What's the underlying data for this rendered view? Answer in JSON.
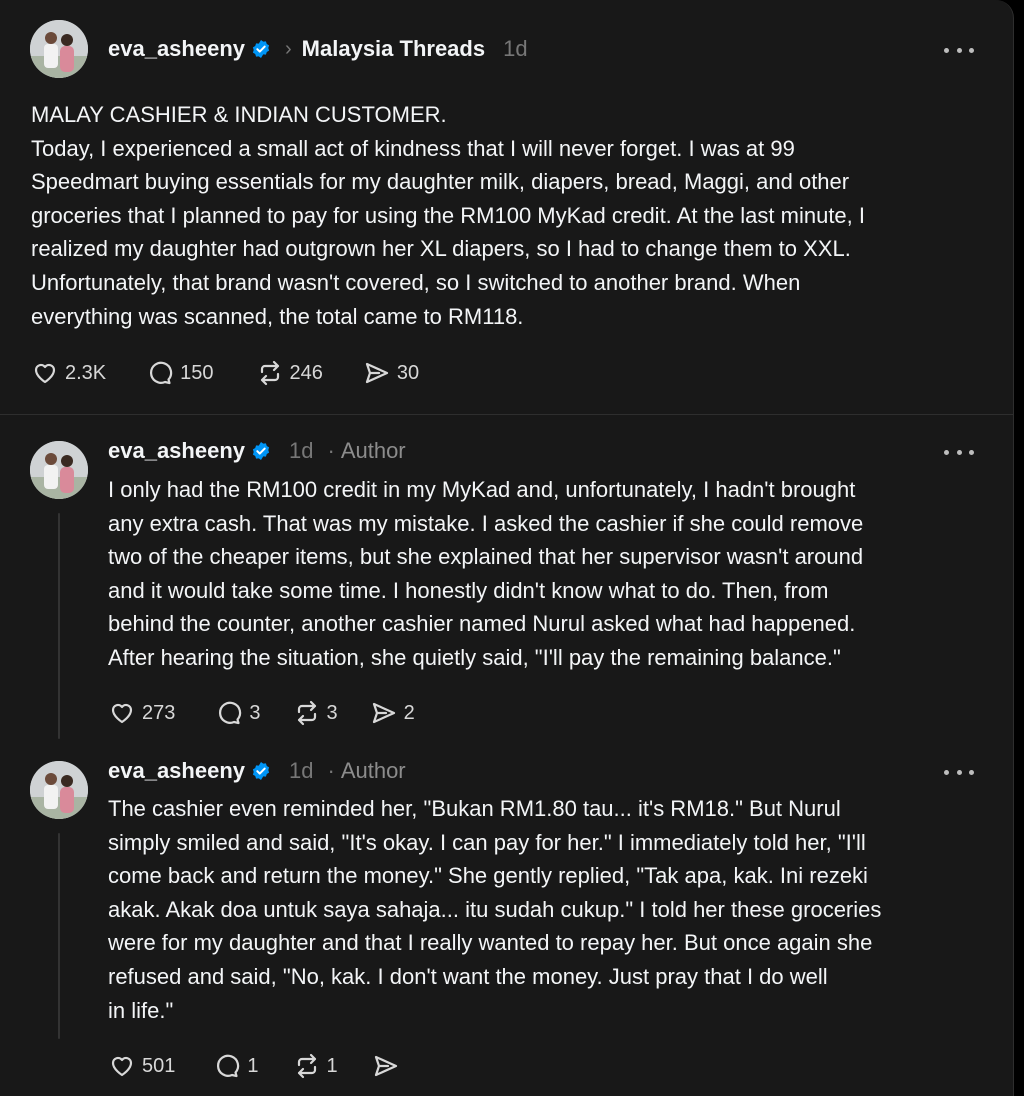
{
  "main_post": {
    "username": "eva_asheeny",
    "community": "Malaysia Threads",
    "time": "1d",
    "lines": [
      "MALAY CASHIER & INDIAN CUSTOMER.",
      "Today, I experienced a small act of kindness that I will never forget. I was at 99",
      "Speedmart buying essentials for my daughter milk, diapers, bread, Maggi, and other",
      "groceries that I planned to pay for using the RM100 MyKad credit. At the last minute, I",
      "realized my daughter had outgrown her XL diapers, so I had to change them to XXL.",
      "Unfortunately, that brand wasn't covered, so I switched to another brand. When",
      "everything was scanned, the total came to RM118."
    ],
    "likes": "2.3K",
    "replies": "150",
    "reposts": "246",
    "shares": "30"
  },
  "reply1": {
    "username": "eva_asheeny",
    "time": "1d",
    "author_label": "Author",
    "lines": [
      "I only had the RM100 credit in my MyKad and, unfortunately, I hadn't brought",
      "any extra cash. That was my mistake. I asked the cashier if she could remove",
      "two of the cheaper items, but she explained that her supervisor wasn't around",
      "and it would take some time. I honestly didn't know what to do. Then, from",
      "behind the counter, another cashier named Nurul asked what had happened.",
      "After hearing the situation, she quietly said, \"I'll pay the remaining balance.\""
    ],
    "likes": "273",
    "replies": "3",
    "reposts": "3",
    "shares": "2"
  },
  "reply2": {
    "username": "eva_asheeny",
    "time": "1d",
    "author_label": "Author",
    "lines": [
      "The cashier even reminded her, \"Bukan RM1.80 tau... it's RM18.\" But Nurul",
      "simply smiled and said, \"It's okay. I can pay for her.\" I immediately told her, \"I'll",
      "come back and return the money.\" She gently replied, \"Tak apa, kak. Ini rezeki",
      "akak. Akak doa untuk saya sahaja... itu sudah cukup.\" I told her these groceries",
      "were for my daughter and that I really wanted to repay her. But once again she",
      "refused and said, \"No, kak. I don't want the money. Just pray that I do well",
      "in life.\""
    ],
    "likes": "501",
    "replies": "1",
    "reposts": "1",
    "shares": ""
  },
  "icons": {
    "like": "heart-icon",
    "reply": "comment-icon",
    "repost": "repost-icon",
    "share": "share-icon",
    "verified": "verified-badge-icon",
    "chevron": "chevron-right-icon",
    "more": "more-icon"
  },
  "colors": {
    "background": "#181818",
    "verified": "#0095f6",
    "secondary_text": "#777777"
  }
}
